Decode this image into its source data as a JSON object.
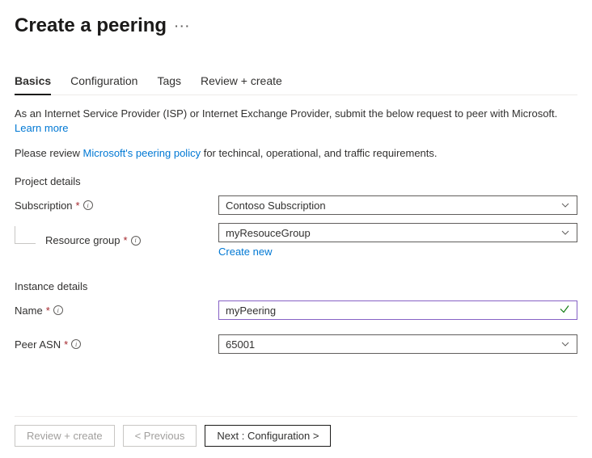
{
  "header": {
    "title": "Create a peering"
  },
  "tabs": [
    {
      "label": "Basics",
      "active": true
    },
    {
      "label": "Configuration",
      "active": false
    },
    {
      "label": "Tags",
      "active": false
    },
    {
      "label": "Review + create",
      "active": false
    }
  ],
  "intro": {
    "text": "As an Internet Service Provider (ISP) or Internet Exchange Provider, submit the below request to peer with Microsoft.",
    "learn_more": "Learn more"
  },
  "policy": {
    "prefix": "Please review ",
    "link": "Microsoft's peering policy",
    "suffix": " for techincal, operational, and traffic requirements."
  },
  "sections": {
    "project_details": "Project details",
    "instance_details": "Instance details"
  },
  "fields": {
    "subscription": {
      "label": "Subscription",
      "value": "Contoso Subscription"
    },
    "resource_group": {
      "label": "Resource group",
      "value": "myResouceGroup",
      "create_new": "Create new"
    },
    "name": {
      "label": "Name",
      "value": "myPeering"
    },
    "peer_asn": {
      "label": "Peer ASN",
      "value": "65001"
    }
  },
  "footer": {
    "review_create": "Review + create",
    "previous": "< Previous",
    "next": "Next : Configuration >"
  }
}
